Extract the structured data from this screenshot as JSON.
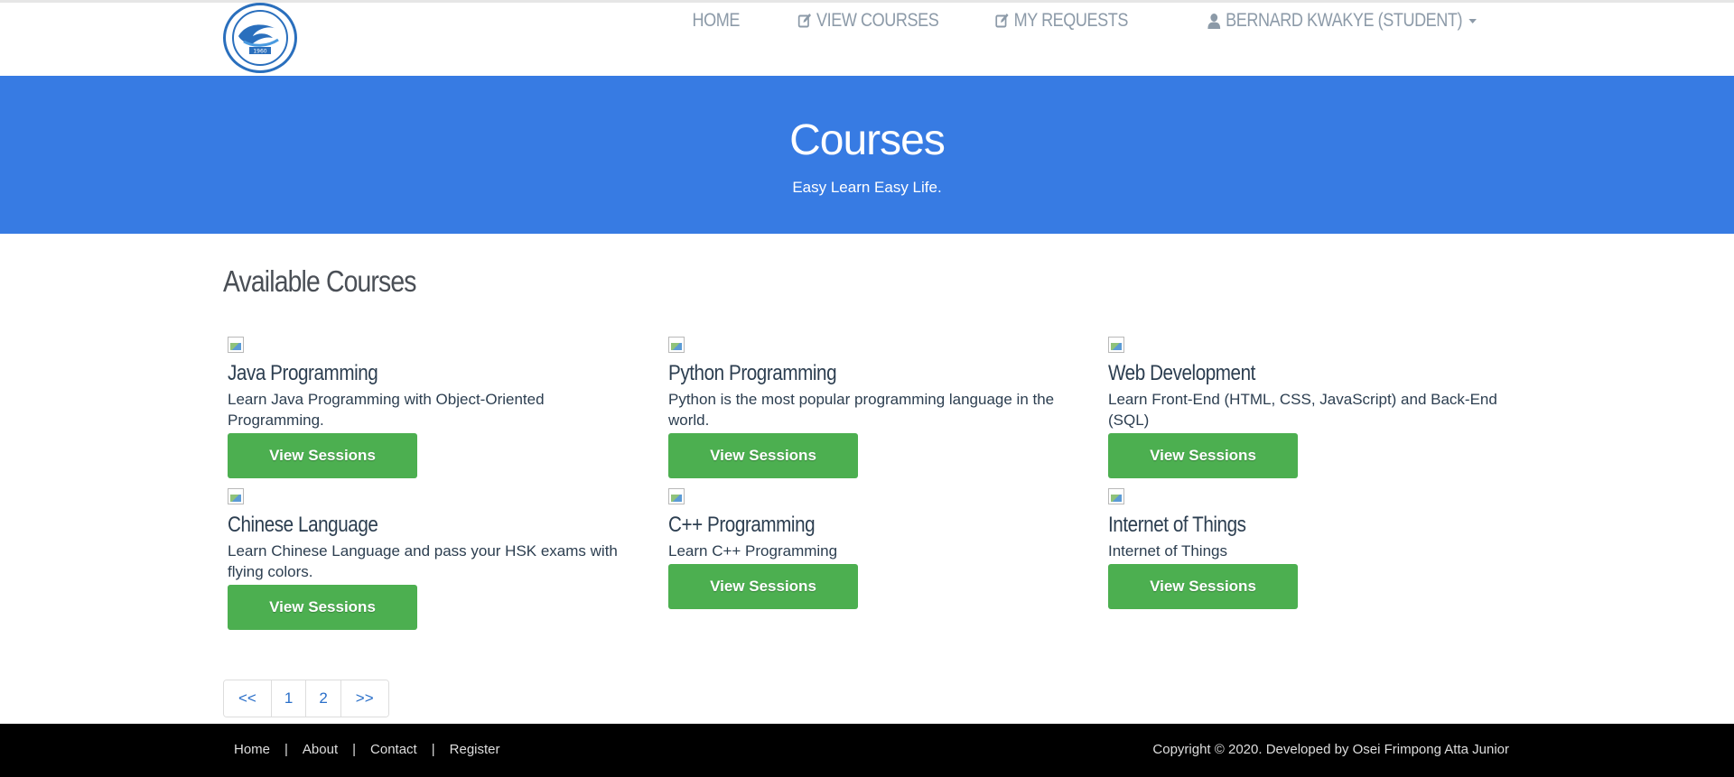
{
  "header": {
    "nav": [
      {
        "label": "HOME",
        "icon": ""
      },
      {
        "label": "VIEW COURSES",
        "icon": "edit-icon"
      },
      {
        "label": "MY REQUESTS",
        "icon": "edit-icon"
      },
      {
        "label": "BERNARD KWAKYE (STUDENT)",
        "icon": "user-icon"
      }
    ],
    "logo_year": "1960"
  },
  "hero": {
    "title": "Courses",
    "subtitle": "Easy Learn Easy Life."
  },
  "main": {
    "section_title": "Available Courses",
    "courses": [
      {
        "title": "Java Programming",
        "description": "Learn Java Programming with Object-Oriented Programming.",
        "button": "View Sessions"
      },
      {
        "title": "Python Programming",
        "description": "Python is the most popular programming language in the world.",
        "button": "View Sessions"
      },
      {
        "title": "Web Development",
        "description": "Learn Front-End (HTML, CSS, JavaScript) and Back-End (SQL)",
        "button": "View Sessions"
      },
      {
        "title": "Chinese Language",
        "description": "Learn Chinese Language and pass your HSK exams with flying colors.",
        "button": "View Sessions"
      },
      {
        "title": "C++ Programming",
        "description": "Learn C++ Programming",
        "button": "View Sessions"
      },
      {
        "title": "Internet of Things",
        "description": "Internet of Things",
        "button": "View Sessions"
      }
    ]
  },
  "pagination": {
    "prev": "<<",
    "pages": [
      "1",
      "2"
    ],
    "next": ">>"
  },
  "footer": {
    "links": [
      "Home",
      "About",
      "Contact",
      "Register"
    ],
    "separator": "|",
    "copyright": "Copyright © 2020. Developed by Osei Frimpong Atta Junior"
  },
  "colors": {
    "hero": "#377be3",
    "button": "#4caf50",
    "footer": "#000000",
    "link": "#2a6fc9"
  }
}
